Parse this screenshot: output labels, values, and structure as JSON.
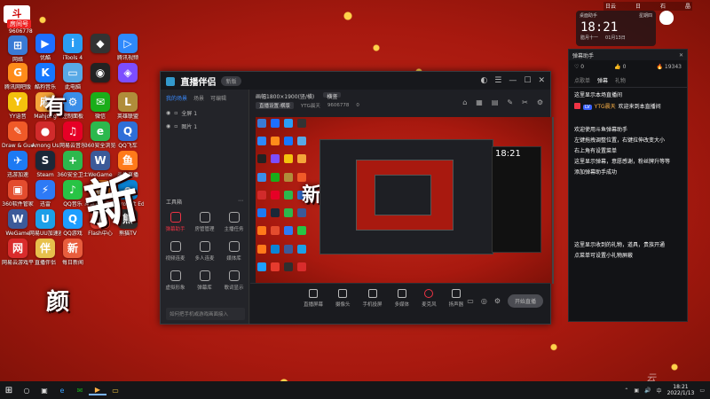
{
  "top_left_badge": {
    "text": "房间号",
    "number": "9606778"
  },
  "desktop_icons": [
    {
      "label": "网络",
      "color": "#3a7bd5",
      "glyph": "⊞"
    },
    {
      "label": "优酷",
      "color": "#1e6fff",
      "glyph": "▶"
    },
    {
      "label": "iTools 4",
      "color": "#2a9df4",
      "glyph": "i"
    },
    {
      "label": "",
      "color": "#333",
      "glyph": "◆"
    },
    {
      "label": "腾讯视频",
      "color": "#2f89fc",
      "glyph": "▷"
    },
    {
      "label": "腾讯网吧版",
      "color": "#ff8c1a",
      "glyph": "G"
    },
    {
      "label": "酷狗音乐",
      "color": "#1677ff",
      "glyph": "K"
    },
    {
      "label": "此电脑",
      "color": "#58a9e6",
      "glyph": "▭"
    },
    {
      "label": "",
      "color": "#222",
      "glyph": "◉"
    },
    {
      "label": "",
      "color": "#7c4dff",
      "glyph": "◈"
    },
    {
      "label": "YY语音",
      "color": "#f4c20d",
      "glyph": "Y"
    },
    {
      "label": "Mahjong",
      "color": "#f4a53a",
      "glyph": "麻"
    },
    {
      "label": "控制面板",
      "color": "#3b8ee8",
      "glyph": "⚙"
    },
    {
      "label": "微信",
      "color": "#1aad19",
      "glyph": "✉"
    },
    {
      "label": "英雄联盟",
      "color": "#b08d3a",
      "glyph": "L"
    },
    {
      "label": "Draw & Guess",
      "color": "#f05a28",
      "glyph": "✎"
    },
    {
      "label": "Among Us",
      "color": "#d12b2b",
      "glyph": "●"
    },
    {
      "label": "网易云音乐",
      "color": "#e60026",
      "glyph": "♫"
    },
    {
      "label": "360安全浏览器",
      "color": "#2db84d",
      "glyph": "e"
    },
    {
      "label": "QQ飞车",
      "color": "#2f6fd8",
      "glyph": "Q"
    },
    {
      "label": "迅游加速",
      "color": "#1d7af3",
      "glyph": "✈"
    },
    {
      "label": "Steam",
      "color": "#1b2838",
      "glyph": "S"
    },
    {
      "label": "360安全卫士",
      "color": "#2db84d",
      "glyph": "+"
    },
    {
      "label": "WeGame",
      "color": "#3c5a99",
      "glyph": "W"
    },
    {
      "label": "斗鱼直播",
      "color": "#ff7a1a",
      "glyph": "鱼"
    },
    {
      "label": "360软件管家",
      "color": "#e34c2e",
      "glyph": "▣"
    },
    {
      "label": "迅雷",
      "color": "#2d7af6",
      "glyph": "⚡"
    },
    {
      "label": "QQ音乐",
      "color": "#28c445",
      "glyph": "♪"
    },
    {
      "label": "斗鱼直播伴侣",
      "color": "#ff7a1a",
      "glyph": "鱼"
    },
    {
      "label": "Microsoft Edge",
      "color": "#0a84d6",
      "glyph": "e"
    },
    {
      "label": "WeGame",
      "color": "#3c5a99",
      "glyph": "W"
    },
    {
      "label": "网易UU加速器",
      "color": "#1c9fe8",
      "glyph": "U"
    },
    {
      "label": "QQ游戏",
      "color": "#1e9eff",
      "glyph": "Q"
    },
    {
      "label": "Flash中心",
      "color": "#e63b2e",
      "glyph": "ƒ"
    },
    {
      "label": "熊猫TV",
      "color": "#2f2f2f",
      "glyph": "熊"
    },
    {
      "label": "网易云游戏平台",
      "color": "#d92c2c",
      "glyph": "网"
    },
    {
      "label": "直播伴侣",
      "color": "#e7c04c",
      "glyph": "伴"
    },
    {
      "label": "每日新闻",
      "color": "#e85d3d",
      "glyph": "新"
    }
  ],
  "bg_chars": [
    "有",
    "新",
    "颜"
  ],
  "window": {
    "logo": "直播伴侣",
    "version": "新版",
    "side_tabs": [
      "我的场景",
      "场景",
      "可编辑"
    ],
    "scenes": [
      "全屏 1",
      "图片 1"
    ],
    "toolbox_title": "工具箱",
    "tools": [
      {
        "label": "弹幕助手",
        "active": true
      },
      {
        "label": "房管管理",
        "active": false
      },
      {
        "label": "主播任务",
        "active": false
      },
      {
        "label": "视频连麦",
        "active": false
      },
      {
        "label": "多人连麦",
        "active": false
      },
      {
        "label": "媒体库",
        "active": false
      },
      {
        "label": "虚拟形象",
        "active": false
      },
      {
        "label": "弹幕库",
        "active": false
      },
      {
        "label": "歌词显示",
        "active": false
      }
    ],
    "footer_tip": "如何把手机或游戏画面接入",
    "resolution": "画幅1800×1900(竖/横)",
    "res_button": "横竖",
    "sub_info": [
      "直播设置:横版",
      "YTG晨天",
      "9606778",
      "0"
    ],
    "bottom_items": [
      "直播屏幕",
      "摄像头",
      "手机投屏",
      "多媒体",
      "麦克风",
      "扬声器"
    ],
    "live_button": "开始直播"
  },
  "dock": {
    "title": "弹幕助手",
    "stats": [
      "0",
      "0",
      "19343"
    ],
    "tabs": [
      "点歌单",
      "弹幕",
      "礼物"
    ],
    "lines": [
      {
        "type": "plain",
        "text": "这里显示本场直播间"
      },
      {
        "type": "user",
        "tag": "LV",
        "name": "YTG晨天",
        "text": "欢迎来到本直播间"
      },
      {
        "type": "plain",
        "text": "欢迎使用斗鱼弹幕助手"
      },
      {
        "type": "plain",
        "text": "左键拖拽调整位置，右键拉伸改变大小"
      },
      {
        "type": "plain",
        "text": "右上角有设置菜单"
      },
      {
        "type": "plain",
        "text": "这里显示弹幕，意愿感谢，粉丝牌升等等"
      },
      {
        "type": "plain",
        "text": "添加弹幕助手成功"
      },
      {
        "type": "plain",
        "text": "这里显示收到的礼物，道具，贵族开通"
      },
      {
        "type": "plain",
        "text": "点菜单可设置小礼物屏蔽"
      }
    ]
  },
  "clock": {
    "header_left": "桌面助手",
    "time": "18:21",
    "date_left": "腊月十一",
    "date_right": "01月13日",
    "weekday": "星期四"
  },
  "top_strip": [
    "日云",
    "日",
    "石",
    "晶"
  ],
  "taskbar": {
    "time": "18:21",
    "date": "2022/1/13",
    "lang": "中"
  },
  "watermark": "云"
}
